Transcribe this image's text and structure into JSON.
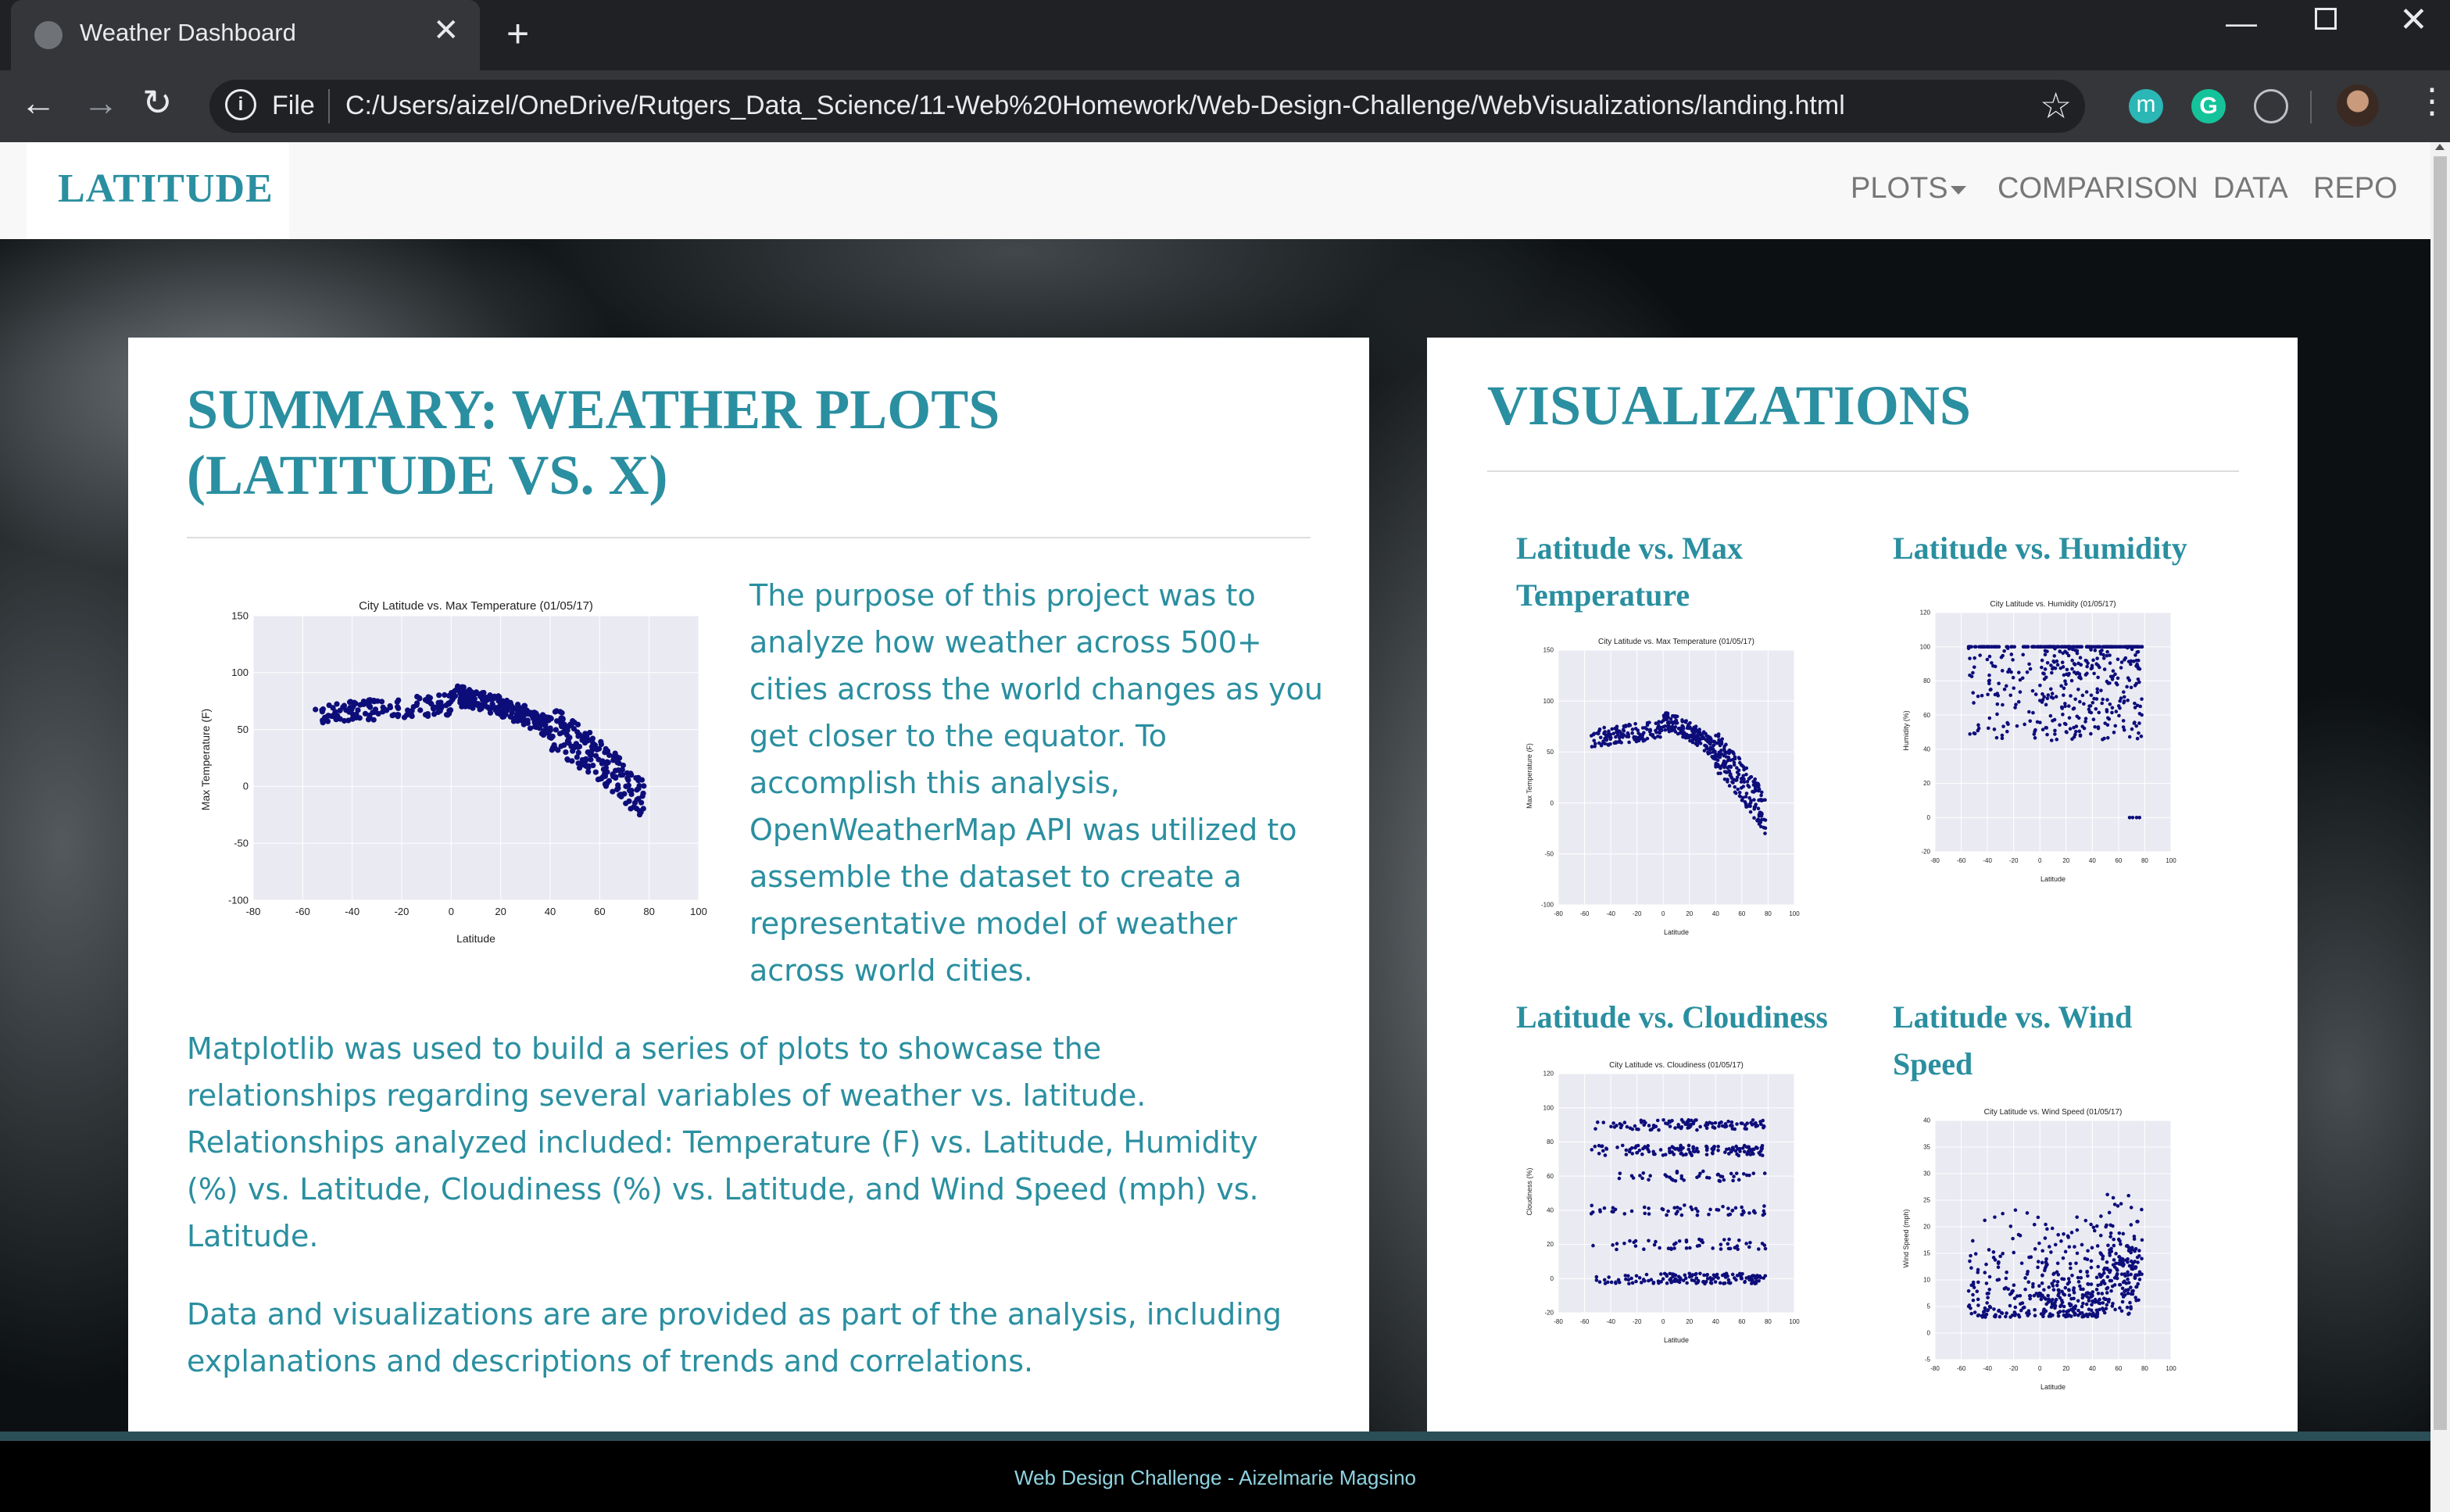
{
  "browser": {
    "tab_title": "Weather Dashboard",
    "tab_close": "✕",
    "new_tab": "+",
    "file_label": "File",
    "url": "C:/Users/aizel/OneDrive/Rutgers_Data_Science/11-Web%20Homework/Web-Design-Challenge/WebVisualizations/landing.html",
    "ext_m": "m",
    "ext_g": "G"
  },
  "navbar": {
    "brand": "LATITUDE",
    "links": [
      "PLOTS",
      "COMPARISON",
      "DATA",
      "REPO"
    ]
  },
  "summary": {
    "heading": "SUMMARY: WEATHER PLOTS (LATITUDE VS. X)",
    "paragraphs": [
      "The purpose of this project was to analyze how weather across 500+ cities across the world changes as you get closer to the equator. To accomplish this analysis, OpenWeatherMap API was utilized to assemble the dataset to create a representative model of weather across world cities.",
      "Matplotlib was used to build a series of plots to showcase the relationships regarding several variables of weather vs. latitude. Relationships analyzed included: Temperature (F) vs. Latitude, Humidity (%) vs. Latitude, Cloudiness (%) vs. Latitude, and Wind Speed (mph) vs. Latitude.",
      "Data and visualizations are are provided as part of the analysis, including explanations and descriptions of trends and correlations."
    ]
  },
  "visualizations": {
    "heading": "VISUALIZATIONS",
    "items": [
      {
        "title": "Latitude vs. Max Temperature"
      },
      {
        "title": "Latitude vs. Humidity"
      },
      {
        "title": "Latitude vs. Cloudiness"
      },
      {
        "title": "Latitude vs. Wind Speed"
      }
    ]
  },
  "footer": {
    "text": "Web Design Challenge - Aizelmarie Magsino"
  },
  "colors": {
    "accent": "#2a8fa0",
    "plot_bg": "#eaeaf2",
    "points": "#0d0d7a"
  },
  "chart_data": [
    {
      "id": "main-temp",
      "type": "scatter",
      "title": "City Latitude vs. Max Temperature (01/05/17)",
      "xlabel": "Latitude",
      "ylabel": "Max Temperature (F)",
      "xlim": [
        -80,
        100
      ],
      "ylim": [
        -100,
        150
      ],
      "xticks": [
        -80,
        -60,
        -40,
        -20,
        0,
        20,
        40,
        60,
        80,
        100
      ],
      "yticks": [
        -100,
        -50,
        0,
        50,
        100,
        150
      ],
      "trend": "temp"
    },
    {
      "id": "thumb-temp",
      "type": "scatter",
      "title": "City Latitude vs. Max Temperature (01/05/17)",
      "xlabel": "Latitude",
      "ylabel": "Max Temperature (F)",
      "xlim": [
        -80,
        100
      ],
      "ylim": [
        -100,
        150
      ],
      "xticks": [
        -80,
        -60,
        -40,
        -20,
        0,
        20,
        40,
        60,
        80,
        100
      ],
      "yticks": [
        -100,
        -50,
        0,
        50,
        100,
        150
      ],
      "trend": "temp"
    },
    {
      "id": "thumb-humidity",
      "type": "scatter",
      "title": "City Latitude vs. Humidity (01/05/17)",
      "xlabel": "Latitude",
      "ylabel": "Humidity (%)",
      "xlim": [
        -80,
        100
      ],
      "ylim": [
        -20,
        120
      ],
      "xticks": [
        -80,
        -60,
        -40,
        -20,
        0,
        20,
        40,
        60,
        80,
        100
      ],
      "yticks": [
        -20,
        0,
        20,
        40,
        60,
        80,
        100,
        120
      ],
      "trend": "humidity"
    },
    {
      "id": "thumb-cloud",
      "type": "scatter",
      "title": "City Latitude vs. Cloudiness (01/05/17)",
      "xlabel": "Latitude",
      "ylabel": "Cloudiness (%)",
      "xlim": [
        -80,
        100
      ],
      "ylim": [
        -20,
        120
      ],
      "xticks": [
        -80,
        -60,
        -40,
        -20,
        0,
        20,
        40,
        60,
        80,
        100
      ],
      "yticks": [
        -20,
        0,
        20,
        40,
        60,
        80,
        100,
        120
      ],
      "trend": "cloud"
    },
    {
      "id": "thumb-wind",
      "type": "scatter",
      "title": "City Latitude vs. Wind Speed (01/05/17)",
      "xlabel": "Latitude",
      "ylabel": "Wind Speed (mph)",
      "xlim": [
        -80,
        100
      ],
      "ylim": [
        -5,
        40
      ],
      "xticks": [
        -80,
        -60,
        -40,
        -20,
        0,
        20,
        40,
        60,
        80,
        100
      ],
      "yticks": [
        -5,
        0,
        5,
        10,
        15,
        20,
        25,
        30,
        35,
        40
      ],
      "trend": "wind"
    }
  ]
}
